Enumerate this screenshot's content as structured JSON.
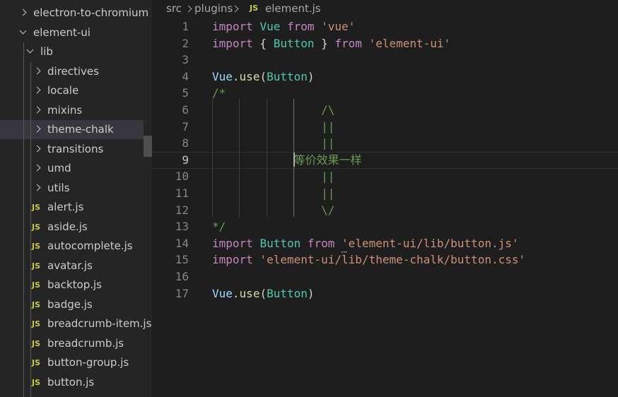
{
  "explorer": {
    "items": [
      {
        "label": "electron-to-chromium",
        "kind": "folder",
        "open": false,
        "depth": 1
      },
      {
        "label": "element-ui",
        "kind": "folder",
        "open": true,
        "depth": 1
      },
      {
        "label": "lib",
        "kind": "folder",
        "open": true,
        "depth": 2
      },
      {
        "label": "directives",
        "kind": "folder",
        "open": false,
        "depth": 3
      },
      {
        "label": "locale",
        "kind": "folder",
        "open": false,
        "depth": 3
      },
      {
        "label": "mixins",
        "kind": "folder",
        "open": false,
        "depth": 3
      },
      {
        "label": "theme-chalk",
        "kind": "folder",
        "open": false,
        "depth": 3,
        "selected": true
      },
      {
        "label": "transitions",
        "kind": "folder",
        "open": false,
        "depth": 3
      },
      {
        "label": "umd",
        "kind": "folder",
        "open": false,
        "depth": 3
      },
      {
        "label": "utils",
        "kind": "folder",
        "open": false,
        "depth": 3
      },
      {
        "label": "alert.js",
        "kind": "js",
        "depth": 3
      },
      {
        "label": "aside.js",
        "kind": "js",
        "depth": 3
      },
      {
        "label": "autocomplete.js",
        "kind": "js",
        "depth": 3
      },
      {
        "label": "avatar.js",
        "kind": "js",
        "depth": 3
      },
      {
        "label": "backtop.js",
        "kind": "js",
        "depth": 3
      },
      {
        "label": "badge.js",
        "kind": "js",
        "depth": 3
      },
      {
        "label": "breadcrumb-item.js",
        "kind": "js",
        "depth": 3
      },
      {
        "label": "breadcrumb.js",
        "kind": "js",
        "depth": 3
      },
      {
        "label": "button-group.js",
        "kind": "js",
        "depth": 3
      },
      {
        "label": "button.js",
        "kind": "js",
        "depth": 3
      }
    ],
    "js_badge": "JS"
  },
  "breadcrumb": {
    "parts": [
      "src",
      "plugins"
    ],
    "file_badge": "JS",
    "file": "element.js"
  },
  "editor": {
    "current_line": 9,
    "lines": [
      {
        "n": "1",
        "tokens": [
          [
            "kw",
            "import"
          ],
          [
            "plain",
            " "
          ],
          [
            "cls",
            "Vue"
          ],
          [
            "plain",
            " "
          ],
          [
            "kw",
            "from"
          ],
          [
            "plain",
            " "
          ],
          [
            "str",
            "'vue'"
          ]
        ]
      },
      {
        "n": "2",
        "tokens": [
          [
            "kw",
            "import"
          ],
          [
            "plain",
            " { "
          ],
          [
            "cls",
            "Button"
          ],
          [
            "plain",
            " } "
          ],
          [
            "kw",
            "from"
          ],
          [
            "plain",
            " "
          ],
          [
            "str",
            "'element-ui'"
          ]
        ]
      },
      {
        "n": "3",
        "tokens": []
      },
      {
        "n": "4",
        "tokens": [
          [
            "ident",
            "Vue"
          ],
          [
            "plain",
            "."
          ],
          [
            "fn",
            "use"
          ],
          [
            "plain",
            "("
          ],
          [
            "cls",
            "Button"
          ],
          [
            "plain",
            ")"
          ]
        ]
      },
      {
        "n": "5",
        "tokens": [
          [
            "cmt",
            "/*"
          ]
        ]
      },
      {
        "n": "6",
        "tokens": [
          [
            "cmt",
            "                /\\"
          ]
        ]
      },
      {
        "n": "7",
        "tokens": [
          [
            "cmt",
            "                ||"
          ]
        ]
      },
      {
        "n": "8",
        "tokens": [
          [
            "cmt",
            "                ||"
          ]
        ]
      },
      {
        "n": "9",
        "tokens": [
          [
            "cmt",
            "            等价效果一样"
          ]
        ]
      },
      {
        "n": "10",
        "tokens": [
          [
            "cmt",
            "                ||"
          ]
        ]
      },
      {
        "n": "11",
        "tokens": [
          [
            "cmt",
            "                ||"
          ]
        ]
      },
      {
        "n": "12",
        "tokens": [
          [
            "cmt",
            "                \\/"
          ]
        ]
      },
      {
        "n": "13",
        "tokens": [
          [
            "cmt",
            "*/"
          ]
        ]
      },
      {
        "n": "14",
        "tokens": [
          [
            "kw",
            "import"
          ],
          [
            "plain",
            " "
          ],
          [
            "cls",
            "Button"
          ],
          [
            "plain",
            " "
          ],
          [
            "kw",
            "from"
          ],
          [
            "plain",
            " "
          ],
          [
            "str",
            "'element-ui/lib/button.js'"
          ]
        ]
      },
      {
        "n": "15",
        "tokens": [
          [
            "kw",
            "import"
          ],
          [
            "plain",
            " "
          ],
          [
            "str",
            "'element-ui/lib/theme-chalk/button.css'"
          ]
        ]
      },
      {
        "n": "16",
        "tokens": []
      },
      {
        "n": "17",
        "tokens": [
          [
            "ident",
            "Vue"
          ],
          [
            "plain",
            "."
          ],
          [
            "fn",
            "use"
          ],
          [
            "plain",
            "("
          ],
          [
            "cls",
            "Button"
          ],
          [
            "plain",
            ")"
          ]
        ]
      }
    ]
  },
  "colors": {
    "background": "#1e1e1e",
    "sidebar": "#252526",
    "keyword": "#c586c0",
    "class": "#4ec9b0",
    "string": "#ce9178",
    "comment": "#6a9955",
    "js_badge": "#cbcb41"
  }
}
